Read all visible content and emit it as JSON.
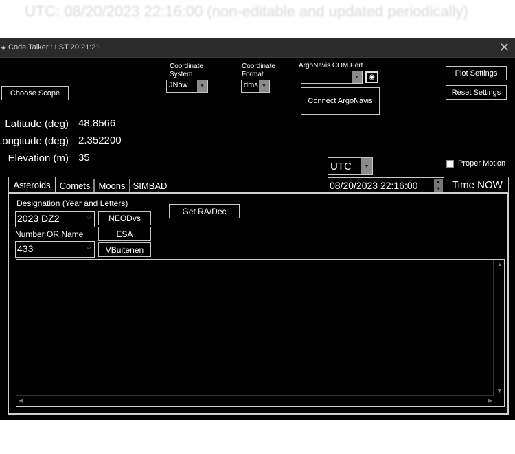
{
  "header": {
    "text": "UTC: 08/20/2023 22:16:00 (non-editable and updated periodically)"
  },
  "window": {
    "title": "Code Talker : LST 20:21:21"
  },
  "toolbar": {
    "choose_scope": "Choose Scope",
    "coord_system_label": [
      "Coordinate",
      "System"
    ],
    "coord_system_value": "JNow",
    "coord_format_label": [
      "Coordinate",
      "Format"
    ],
    "coord_format_value": "dms",
    "com_port_label": "ArgoNavis COM Port",
    "com_port_value": "",
    "connect_label": "Connect ArgoNavis",
    "plot_settings": "Plot Settings",
    "reset_settings": "Reset Settings"
  },
  "location": {
    "latitude_label": "Latitude (deg)",
    "latitude_value": "48.8566",
    "longitude_label": "Longitude (deg)",
    "longitude_value": "2.352200",
    "elevation_label": "Elevation (m)",
    "elevation_value": "35"
  },
  "time": {
    "timezone": "UTC",
    "datetime": "08/20/2023 22:16:00",
    "time_now": "Time NOW",
    "proper_motion_label": "Proper Motion",
    "proper_motion_checked": false
  },
  "tabs": [
    "Asteroids",
    "Comets",
    "Moons",
    "SIMBAD"
  ],
  "asteroids": {
    "designation_label": "Designation (Year and Letters)",
    "designation_value": "2023 DZ2",
    "number_label": "Number OR Name",
    "number_value": "433",
    "neodys": "NEODvs",
    "esa": "ESA",
    "vbuitenen": "VBuitenen",
    "get_radec": "Get RA/Dec",
    "output": ""
  },
  "colors": {
    "window_bg": "#000000",
    "titlebar_bg": "#2b2b2b",
    "border": "#c8c8c8"
  }
}
